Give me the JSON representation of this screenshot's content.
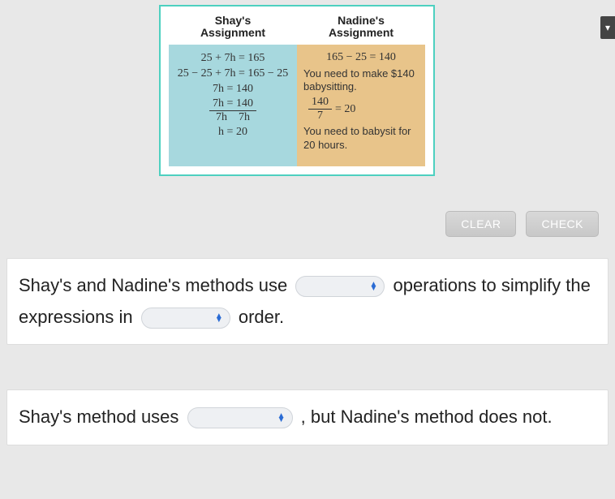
{
  "work": {
    "shay": {
      "title_l1": "Shay's",
      "title_l2": "Assignment",
      "l1": "25 + 7h = 165",
      "l2": "25 − 25 + 7h = 165 − 25",
      "l3": "7h = 140",
      "frac_num": "7h = 140",
      "frac_den_left": "7h",
      "frac_den_right": "7h",
      "l5": "h  = 20"
    },
    "nadine": {
      "title_l1": "Nadine's",
      "title_l2": "Assignment",
      "m1": "165 − 25 = 140",
      "t1": "You need to make $140 babysitting.",
      "frac_num": "140",
      "frac_den": "7",
      "frac_eq": "= 20",
      "t2": "You need to babysit for 20 hours."
    }
  },
  "buttons": {
    "clear": "CLEAR",
    "check": "CHECK"
  },
  "s1": {
    "p1": "Shay's and Nadine's methods use ",
    "p2": " operations to simplify the expressions in ",
    "p3": " order."
  },
  "s2": {
    "p1": "Shay's method uses ",
    "p2": " , but Nadine's method does not."
  }
}
